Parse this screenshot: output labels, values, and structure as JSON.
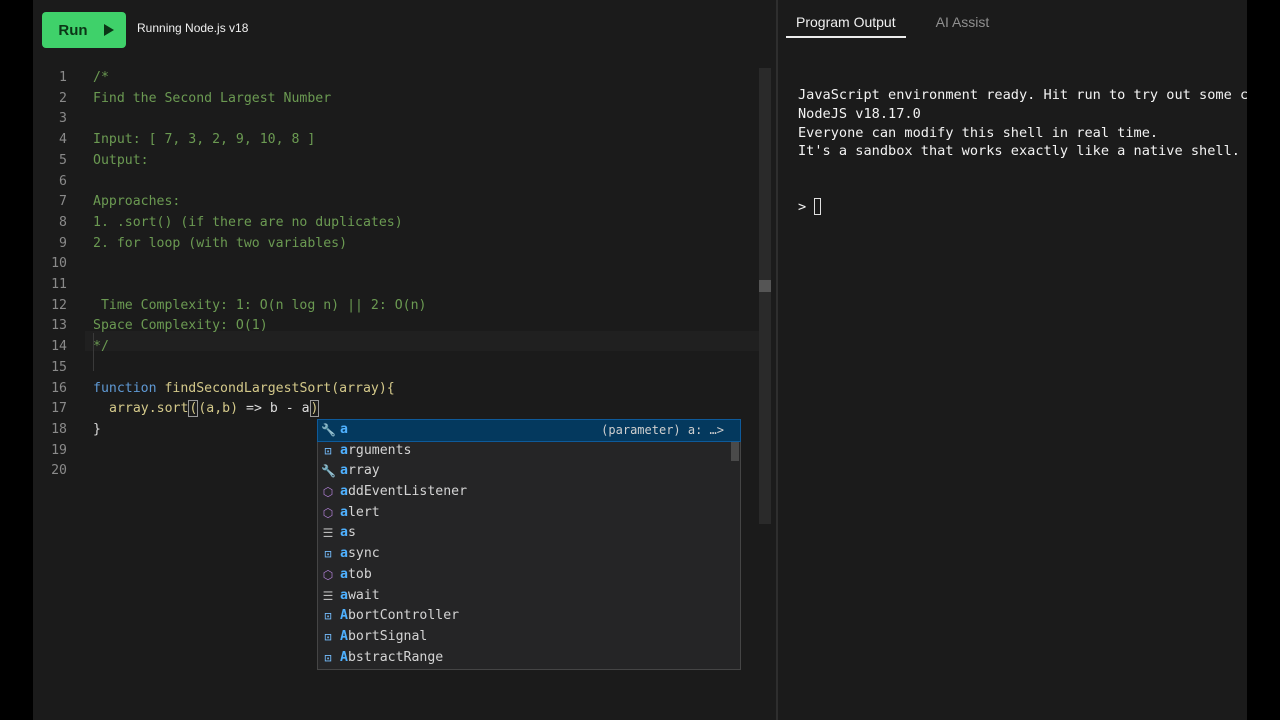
{
  "toolbar": {
    "run_label": "Run",
    "status": "Running Node.js v18"
  },
  "editor": {
    "lines": [
      {
        "n": "1",
        "text": "/*"
      },
      {
        "n": "2",
        "text": "Find the Second Largest Number"
      },
      {
        "n": "3",
        "text": ""
      },
      {
        "n": "4",
        "text": "Input: [ 7, 3, 2, 9, 10, 8 ]"
      },
      {
        "n": "5",
        "text": "Output: "
      },
      {
        "n": "6",
        "text": ""
      },
      {
        "n": "7",
        "text": "Approaches:"
      },
      {
        "n": "8",
        "text": "1. .sort() (if there are no duplicates)"
      },
      {
        "n": "9",
        "text": "2. for loop (with two variables)"
      },
      {
        "n": "10",
        "text": ""
      },
      {
        "n": "11",
        "text": ""
      },
      {
        "n": "12",
        "text": " Time Complexity: 1: O(n log n) || 2: O(n)"
      },
      {
        "n": "13",
        "text": "Space Complexity: O(1)"
      },
      {
        "n": "14",
        "text": "*/"
      },
      {
        "n": "15",
        "text": ""
      },
      {
        "n": "16",
        "kw": "function",
        "fn": "findSecondLargestSort",
        "rest": "(array){"
      },
      {
        "n": "17",
        "a": "array.sort",
        "b": "(",
        "c": "(a,b)",
        "d": " => b - a",
        "e": ")"
      },
      {
        "n": "18",
        "text": "}"
      },
      {
        "n": "19",
        "text": ""
      },
      {
        "n": "20",
        "text": ""
      }
    ]
  },
  "suggest": {
    "items": [
      {
        "hl": "a",
        "rest": "",
        "icon": "wrench-icon",
        "glyph": "🔧",
        "detail": "(parameter) a: …>"
      },
      {
        "hl": "a",
        "rest": "rguments",
        "icon": "variable-icon",
        "glyph": "⊡"
      },
      {
        "hl": "a",
        "rest": "rray",
        "icon": "wrench-icon",
        "glyph": "🔧"
      },
      {
        "hl": "a",
        "rest": "ddEventListener",
        "icon": "cube-icon",
        "glyph": "⬡"
      },
      {
        "hl": "a",
        "rest": "lert",
        "icon": "cube-icon",
        "glyph": "⬡"
      },
      {
        "hl": "a",
        "rest": "s",
        "icon": "keyword-icon",
        "glyph": "☰"
      },
      {
        "hl": "a",
        "rest": "sync",
        "icon": "variable-icon",
        "glyph": "⊡"
      },
      {
        "hl": "a",
        "rest": "tob",
        "icon": "cube-icon",
        "glyph": "⬡"
      },
      {
        "hl": "a",
        "rest": "wait",
        "icon": "keyword-icon",
        "glyph": "☰"
      },
      {
        "hl": "A",
        "rest": "bortController",
        "icon": "variable-icon",
        "glyph": "⊡"
      },
      {
        "hl": "A",
        "rest": "bortSignal",
        "icon": "variable-icon",
        "glyph": "⊡"
      },
      {
        "hl": "A",
        "rest": "bstractRange",
        "icon": "variable-icon",
        "glyph": "⊡"
      }
    ]
  },
  "output": {
    "tabs": [
      "Program Output",
      "AI Assist"
    ],
    "console": "JavaScript environment ready. Hit run to try out some code!\nNodeJS v18.17.0\nEveryone can modify this shell in real time.\nIt's a sandbox that works exactly like a native shell.",
    "prompt": ">"
  },
  "colors": {
    "run_button": "#3fd16a",
    "comment": "#6b9a52",
    "keyword": "#5f99d4",
    "function_name": "#d4c98a",
    "suggest_highlight": "#4fb1ff",
    "selected_row": "#04395e"
  }
}
